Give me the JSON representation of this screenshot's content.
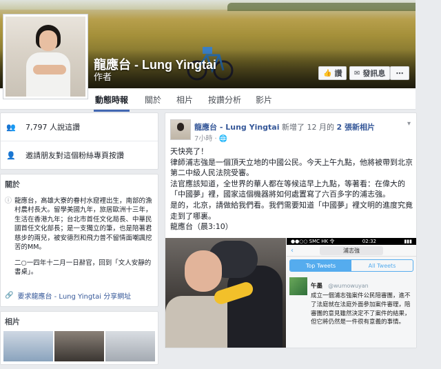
{
  "profile": {
    "name": "龍應台 - Lung Yingtai",
    "category": "作者"
  },
  "actions": {
    "like": "讚",
    "message": "發訊息",
    "more": "⋯"
  },
  "tabs": [
    "動態時報",
    "關於",
    "相片",
    "按讚分析",
    "影片"
  ],
  "sidebar": {
    "likes": "7,797 人說這讚",
    "invite": "邀請朋友對這個粉絲專頁按讚",
    "about_title": "關於",
    "about_p1": "龍應台，高雄大寮的眷村水窟裡出生，南部的漁村農村長大。留學美國九年，旅居歐洲十三年，生活在香港九年；台北市首任文化局長、中華民國首任文化部長；是一支獨立的筆，也是陪著君慈步的兩兒，被安德烈和飛力普不留情面嘲諷挖苦的MM。",
    "about_p2": "二○一四年十二月一日辭官，回到「文人安靜的書桌」。",
    "suggest_edit": "要求龍應台 - Lung Yingtai 分享網址",
    "photos_title": "相片"
  },
  "post": {
    "author": "龍應台 - Lung Yingtai",
    "action_text": "新增了 12 月的",
    "photo_link": "2 張新相片",
    "time": "7小時 · 🌐",
    "lines": [
      "天快亮了！",
      "律師浦志強是一個頂天立地的中國公民。今天上午九點，他將被帶到北京第二中級人民法院受審。",
      "法官應該知道，全世界的華人都在等候這早上九點，等著看：在偉大的「中國夢」裡，國家這個機器將如何處置寫了六百多字的浦志強。",
      "是的，北京，請做給我們看。我們需要知道「中國夢」裡文明的進度究竟走到了哪裏。",
      "龍應台（晨3:10）"
    ]
  },
  "phone": {
    "carrier": "●●○○ SMC HK 令",
    "clock": "02:32",
    "battery": "▮▮▮",
    "search": "浦志強",
    "tab_top": "Top Tweets",
    "tab_all": "All Tweets",
    "tweet_name": "午墨",
    "tweet_handle": "@wumowuyan",
    "tweet_text": "成立一個浦志強案件公民陪審團，進不了法庭就在法庭外面參加案件審理，陪審團的意見雖然決定不了案件的結果，但它將仍然是一件很有意義的事情。"
  }
}
